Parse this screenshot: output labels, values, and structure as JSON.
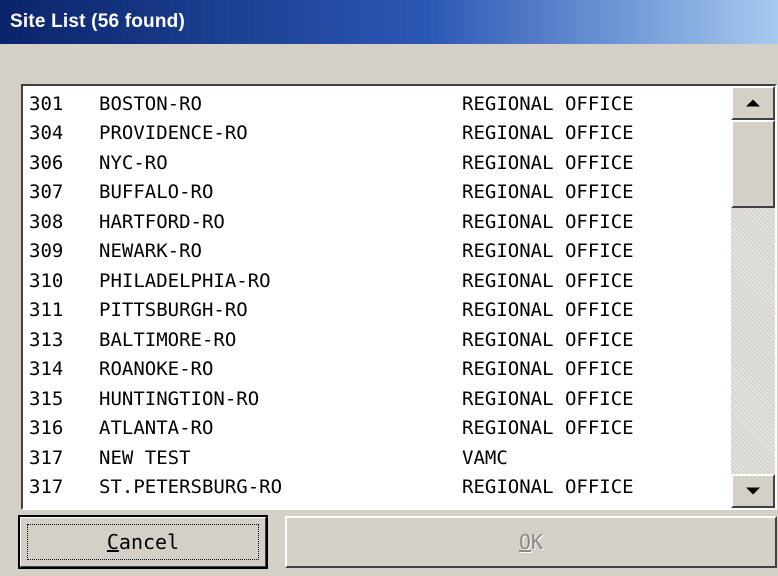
{
  "window": {
    "title": "Site List (56 found)"
  },
  "site_list": {
    "rows": [
      {
        "id": "301",
        "name": "BOSTON-RO",
        "type": "REGIONAL OFFICE"
      },
      {
        "id": "304",
        "name": "PROVIDENCE-RO",
        "type": "REGIONAL OFFICE"
      },
      {
        "id": "306",
        "name": "NYC-RO",
        "type": "REGIONAL OFFICE"
      },
      {
        "id": "307",
        "name": "BUFFALO-RO",
        "type": "REGIONAL OFFICE"
      },
      {
        "id": "308",
        "name": "HARTFORD-RO",
        "type": "REGIONAL OFFICE"
      },
      {
        "id": "309",
        "name": "NEWARK-RO",
        "type": "REGIONAL OFFICE"
      },
      {
        "id": "310",
        "name": "PHILADELPHIA-RO",
        "type": "REGIONAL OFFICE"
      },
      {
        "id": "311",
        "name": "PITTSBURGH-RO",
        "type": "REGIONAL OFFICE"
      },
      {
        "id": "313",
        "name": "BALTIMORE-RO",
        "type": "REGIONAL OFFICE"
      },
      {
        "id": "314",
        "name": "ROANOKE-RO",
        "type": "REGIONAL OFFICE"
      },
      {
        "id": "315",
        "name": "HUNTINGTION-RO",
        "type": "REGIONAL OFFICE"
      },
      {
        "id": "316",
        "name": "ATLANTA-RO",
        "type": "REGIONAL OFFICE"
      },
      {
        "id": "317",
        "name": "NEW TEST",
        "type": "VAMC"
      },
      {
        "id": "317",
        "name": "ST.PETERSBURG-RO",
        "type": "REGIONAL OFFICE"
      }
    ]
  },
  "scrollbar": {
    "up_icon": "arrow-up",
    "down_icon": "arrow-down"
  },
  "buttons": {
    "cancel_label": "Cancel",
    "ok_label": "OK"
  },
  "colors": {
    "titlebar_start": "#0a246a",
    "titlebar_end": "#a6caf0",
    "face": "#d4d0c8",
    "disabled_text": "#8c8a85"
  }
}
